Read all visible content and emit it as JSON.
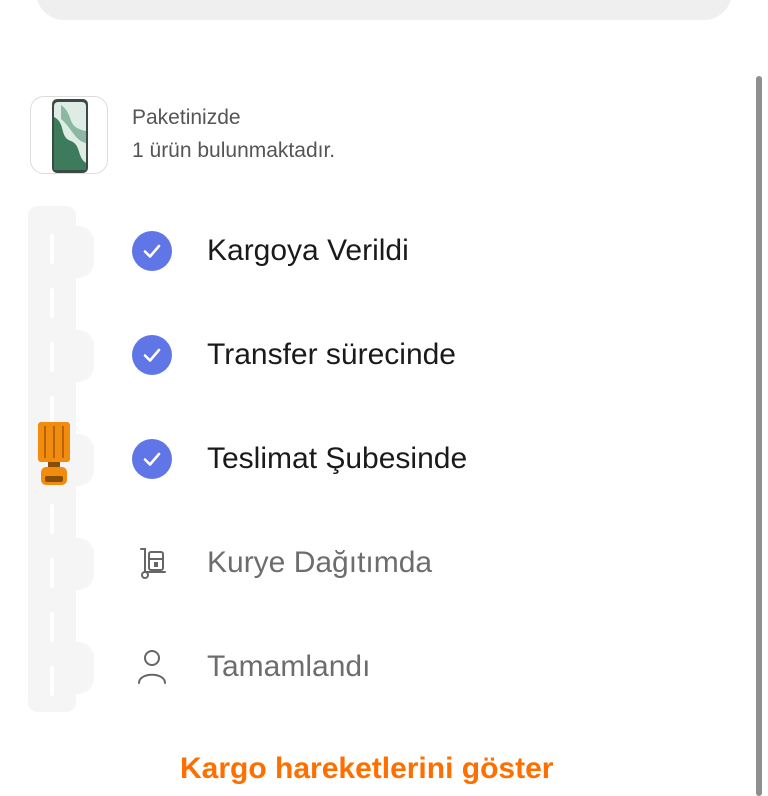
{
  "package": {
    "line1": "Paketinizde",
    "line2": "1 ürün bulunmaktadır."
  },
  "steps": [
    {
      "label": "Kargoya Verildi",
      "status": "done",
      "icon": "check-icon"
    },
    {
      "label": "Transfer sürecinde",
      "status": "done",
      "icon": "check-icon"
    },
    {
      "label": "Teslimat Şubesinde",
      "status": "done",
      "icon": "check-icon"
    },
    {
      "label": "Kurye Dağıtımda",
      "status": "pending",
      "icon": "hand-truck-icon"
    },
    {
      "label": "Tamamlandı",
      "status": "pending",
      "icon": "person-icon"
    }
  ],
  "bottom_link": "Kargo hareketlerini göster",
  "colors": {
    "accent_blue": "#6176e6",
    "accent_orange": "#ff6f00",
    "truck": "#f28c0f"
  }
}
